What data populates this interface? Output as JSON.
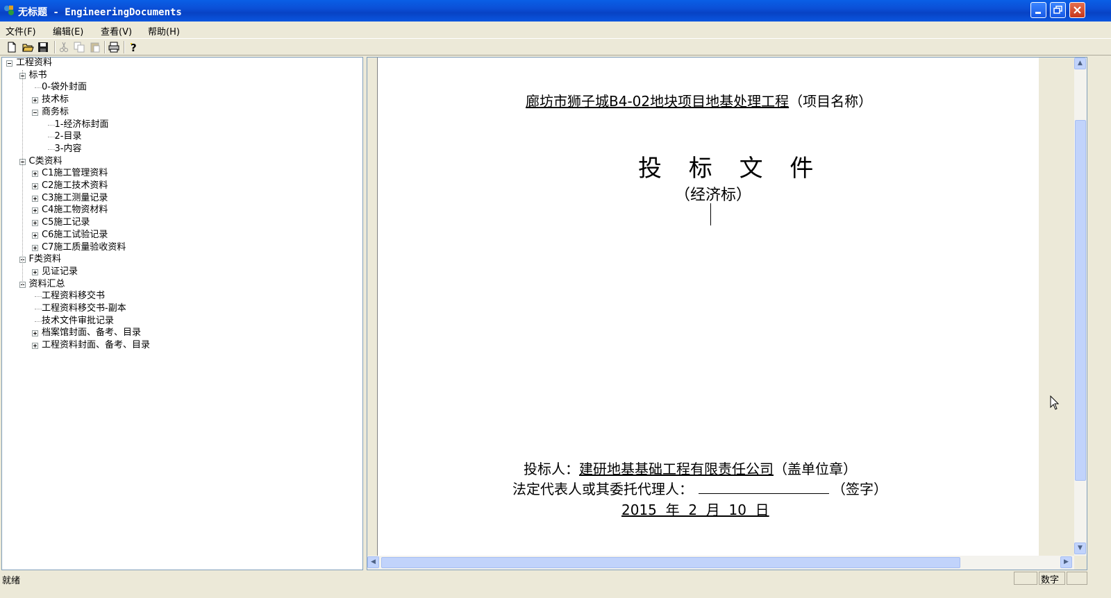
{
  "window": {
    "title": "无标题 - EngineeringDocuments"
  },
  "menu": {
    "items": [
      "文件(F)",
      "编辑(E)",
      "查看(V)",
      "帮助(H)"
    ]
  },
  "toolbar": {
    "buttons": [
      "new-icon",
      "open-icon",
      "save-icon",
      "cut-icon",
      "copy-icon",
      "paste-icon",
      "print-icon",
      "help-icon"
    ]
  },
  "tree": {
    "items": [
      {
        "label": "工程资料",
        "level": 0,
        "expander": "minus"
      },
      {
        "label": "标书",
        "level": 1,
        "expander": "minus"
      },
      {
        "label": "0-袋外封面",
        "level": 2,
        "expander": ""
      },
      {
        "label": "技术标",
        "level": 2,
        "expander": "plus"
      },
      {
        "label": "商务标",
        "level": 2,
        "expander": "minus"
      },
      {
        "label": "1-经济标封面",
        "level": 3,
        "expander": ""
      },
      {
        "label": "2-目录",
        "level": 3,
        "expander": ""
      },
      {
        "label": "3-内容",
        "level": 3,
        "expander": ""
      },
      {
        "label": "C类资料",
        "level": 1,
        "expander": "minus"
      },
      {
        "label": "C1施工管理资料",
        "level": 2,
        "expander": "plus"
      },
      {
        "label": "C2施工技术资料",
        "level": 2,
        "expander": "plus"
      },
      {
        "label": "C3施工测量记录",
        "level": 2,
        "expander": "plus"
      },
      {
        "label": "C4施工物资材料",
        "level": 2,
        "expander": "plus"
      },
      {
        "label": "C5施工记录",
        "level": 2,
        "expander": "plus"
      },
      {
        "label": "C6施工试验记录",
        "level": 2,
        "expander": "plus"
      },
      {
        "label": "C7施工质量验收资料",
        "level": 2,
        "expander": "plus"
      },
      {
        "label": "F类资料",
        "level": 1,
        "expander": "minus"
      },
      {
        "label": "见证记录",
        "level": 2,
        "expander": "plus"
      },
      {
        "label": "资料汇总",
        "level": 1,
        "expander": "minus"
      },
      {
        "label": "工程资料移交书",
        "level": 2,
        "expander": ""
      },
      {
        "label": "工程资料移交书-副本",
        "level": 2,
        "expander": ""
      },
      {
        "label": "技术文件审批记录",
        "level": 2,
        "expander": ""
      },
      {
        "label": "档案馆封面、备考、目录",
        "level": 2,
        "expander": "plus"
      },
      {
        "label": "工程资料封面、备考、目录",
        "level": 2,
        "expander": "plus"
      }
    ]
  },
  "document": {
    "project_name": "廊坊市狮子城B4-02地块项目地基处理工程",
    "project_name_suffix": "（项目名称）",
    "heading": "投 标 文 件",
    "subheading": "（经济标）",
    "bidder_label": "投标人：",
    "bidder_name": "建研地基基础工程有限责任公司",
    "bidder_suffix": "（盖单位章）",
    "rep_label": "法定代表人或其委托代理人：",
    "rep_blank": "                ",
    "rep_suffix": "（签字）",
    "date": "2015  年  2  月  10  日"
  },
  "status": {
    "text": "就绪",
    "indicator_empty": "",
    "indicator_num": "数字"
  }
}
